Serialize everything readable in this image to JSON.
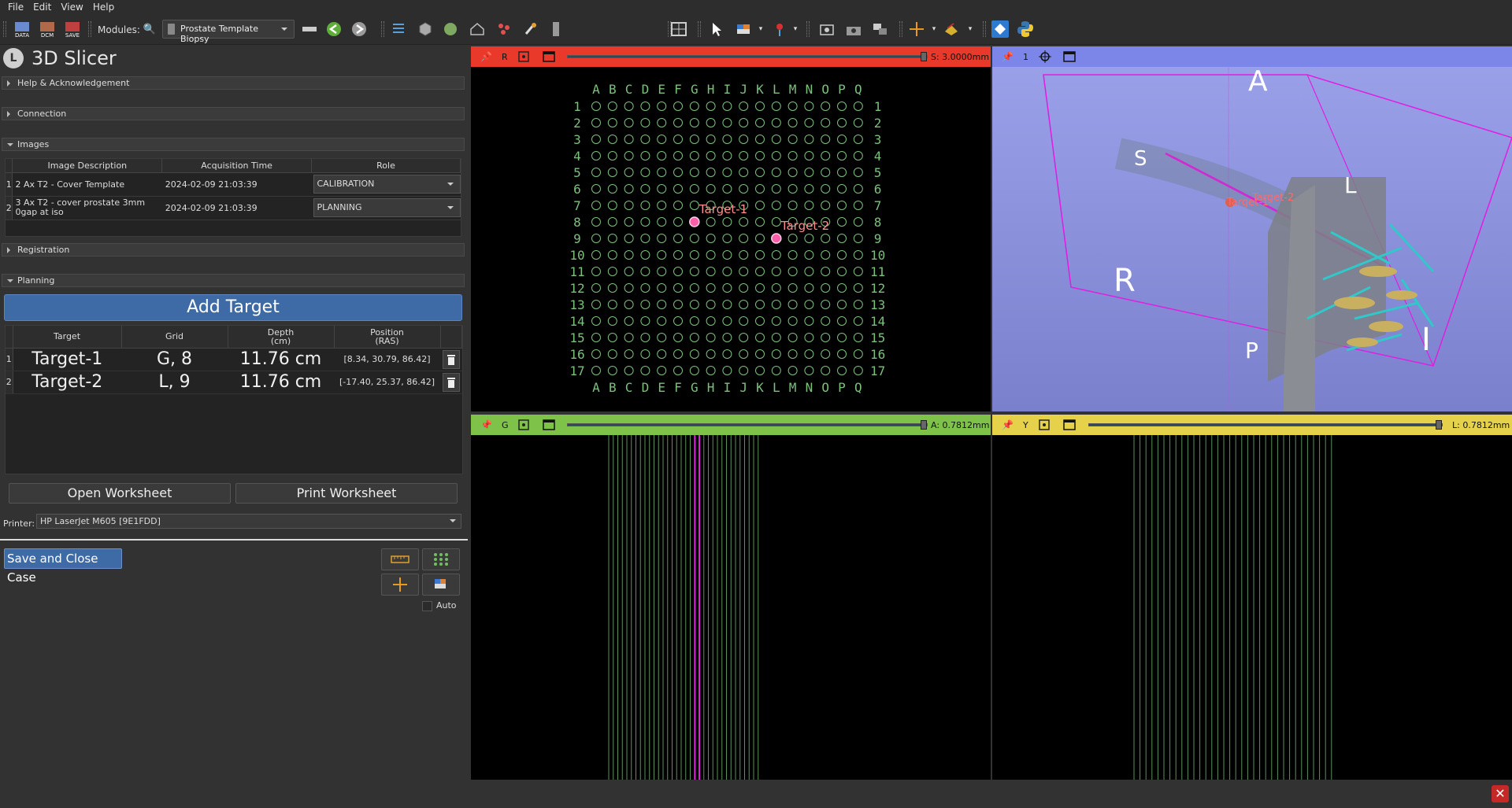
{
  "menu": [
    "File",
    "Edit",
    "View",
    "Help"
  ],
  "toolbar": {
    "modules_label": "Modules:",
    "module_selected": "Prostate Template Biopsy",
    "data_label": "DATA",
    "dcm_label": "DCM",
    "save_label": "SAVE"
  },
  "app_title": "3D Slicer",
  "sections": {
    "help": "Help & Acknowledgement",
    "connection": "Connection",
    "images": "Images",
    "registration": "Registration",
    "planning": "Planning"
  },
  "images_table": {
    "headers": [
      "Image Description",
      "Acquisition Time",
      "Role"
    ],
    "rows": [
      {
        "num": "1",
        "desc": "2 Ax T2 - Cover Template",
        "time": "2024-02-09 21:03:39",
        "role": "CALIBRATION"
      },
      {
        "num": "2",
        "desc": "3 Ax T2 - cover prostate 3mm 0gap at iso",
        "time": "2024-02-09 21:03:39",
        "role": "PLANNING"
      }
    ]
  },
  "planning": {
    "add_target": "Add Target",
    "headers": {
      "target": "Target",
      "grid": "Grid",
      "depth": "Depth",
      "depth_unit": "(cm)",
      "position": "Position",
      "position_unit": "(RAS)"
    },
    "targets": [
      {
        "num": "1",
        "name": "Target-1",
        "grid": "G, 8",
        "depth": "11.76 cm",
        "position": "[8.34, 30.79, 86.42]"
      },
      {
        "num": "2",
        "name": "Target-2",
        "grid": "L, 9",
        "depth": "11.76 cm",
        "position": "[-17.40, 25.37, 86.42]"
      }
    ],
    "open_worksheet": "Open Worksheet",
    "print_worksheet": "Print Worksheet",
    "printer_label": "Printer:",
    "printer_value": "HP LaserJet M605 [9E1FDD]"
  },
  "footer": {
    "save_close": "Save and Close Case",
    "auto_label": "Auto"
  },
  "views": {
    "red": {
      "label": "R",
      "value": "S: 3.0000mm",
      "color": "#e8392b"
    },
    "threeD": {
      "label": "1",
      "color": "#7b86e8",
      "orient": {
        "A": "A",
        "S": "S",
        "L": "L",
        "R": "R",
        "P": "P",
        "I": "I"
      },
      "t1": "Target-1",
      "t2": "Target-2"
    },
    "green": {
      "label": "G",
      "value": "A: 0.7812mm",
      "color": "#7ec24a"
    },
    "yellow": {
      "label": "Y",
      "value": "L: 0.7812mm",
      "color": "#e6d24a"
    }
  },
  "grid": {
    "cols": [
      "A",
      "B",
      "C",
      "D",
      "E",
      "F",
      "G",
      "H",
      "I",
      "J",
      "K",
      "L",
      "M",
      "N",
      "O",
      "P",
      "Q"
    ],
    "rows": [
      "1",
      "2",
      "3",
      "4",
      "5",
      "6",
      "7",
      "8",
      "9",
      "10",
      "11",
      "12",
      "13",
      "14",
      "15",
      "16",
      "17"
    ],
    "targets": [
      {
        "label": "Target-1",
        "col": "G",
        "row": "8"
      },
      {
        "label": "Target-2",
        "col": "L",
        "row": "9"
      }
    ]
  },
  "colors": {
    "accent": "#3e6aa6",
    "grid_green": "#7cc07c",
    "target_pink": "#ff5fa8",
    "target_label": "#ff8f8f",
    "magenta": "#e01fe0"
  }
}
